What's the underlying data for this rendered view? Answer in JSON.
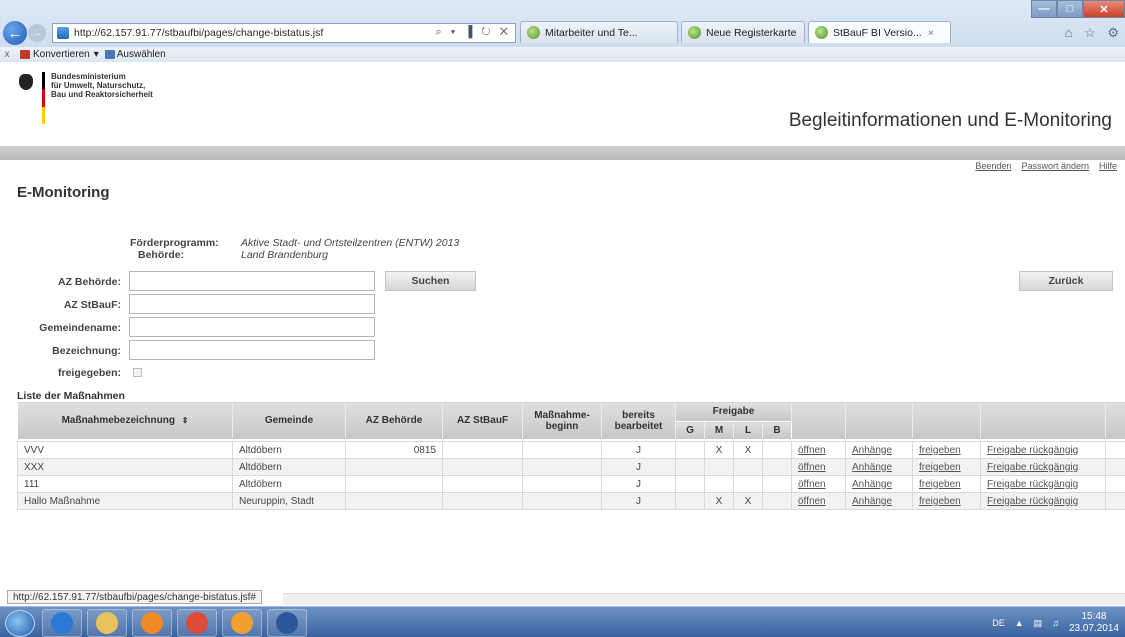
{
  "browser": {
    "url": "http://62.157.91.77/stbaufbi/pages/change-bistatus.jsf",
    "address_controls": "⌕ ▾ ▐ ↻ ✕",
    "tabs": [
      {
        "label": "Mitarbeiter und Te..."
      },
      {
        "label": "Neue Registerkarte"
      },
      {
        "label": "StBauF BI Versio...",
        "active": true
      }
    ],
    "tab_close": "×",
    "commandbar": {
      "close": "x",
      "convert": "Konvertieren",
      "convert_caret": "▾",
      "select": "Auswählen"
    },
    "window_buttons": {
      "minimize": "—",
      "maximize": "□",
      "close": "✕"
    },
    "right_icons": "⌂ ☆ ⚙"
  },
  "header": {
    "ministry_lines": [
      "Bundesministerium",
      "für Umwelt, Naturschutz,",
      "Bau und Reaktorsicherheit"
    ],
    "app_title": "Begleitinformationen und E-Monitoring",
    "links": [
      "Beenden",
      "Passwort ändern",
      "Hilfe"
    ],
    "flag_colors": [
      "#000000",
      "#dd0000",
      "#ffcc00"
    ]
  },
  "page": {
    "title": "E-Monitoring",
    "meta": [
      {
        "label": "Förderprogramm:",
        "value": "Aktive Stadt- und Ortsteilzentren (ENTW) 2013"
      },
      {
        "label": "Behörde:",
        "value": "Land Brandenburg"
      }
    ],
    "form": {
      "az_behoerde": {
        "label": "AZ Behörde:",
        "value": ""
      },
      "az_stbauf": {
        "label": "AZ StBauF:",
        "value": ""
      },
      "gemeindename": {
        "label": "Gemeindename:",
        "value": ""
      },
      "bezeichnung": {
        "label": "Bezeichnung:",
        "value": ""
      },
      "freigegeben": {
        "label": "freigegeben:",
        "checked": false
      }
    },
    "search_button": "Suchen",
    "back_button": "Zurück",
    "list_title": "Liste der Maßnahmen"
  },
  "table": {
    "headers": {
      "name": "Maßnahmebezeichnung",
      "sort_icon": "⇕",
      "gemeinde": "Gemeinde",
      "az_behoerde": "AZ Behörde",
      "az_stbauf": "AZ StBauF",
      "beginn": "Maßnahme-beginn",
      "bearbeitet": "bereits bearbeitet",
      "freigabe": "Freigabe",
      "g": "G",
      "m": "M",
      "l": "L",
      "b": "B"
    },
    "rows": [
      {
        "name": "VVV",
        "gemeinde": "Altdöbern",
        "az_behoerde": "0815",
        "az_stbauf": "",
        "beginn": "",
        "bearbeitet": "J",
        "g": "",
        "m": "X",
        "l": "X",
        "b": "",
        "open": "öffnen",
        "attach": "Anhänge",
        "release": "freigeben",
        "undo": "Freigabe rückgängig"
      },
      {
        "name": "XXX",
        "gemeinde": "Altdöbern",
        "az_behoerde": "",
        "az_stbauf": "",
        "beginn": "",
        "bearbeitet": "J",
        "g": "",
        "m": "",
        "l": "",
        "b": "",
        "open": "öffnen",
        "attach": "Anhänge",
        "release": "freigeben",
        "undo": "Freigabe rückgängig"
      },
      {
        "name": "111",
        "gemeinde": "Altdöbern",
        "az_behoerde": "",
        "az_stbauf": "",
        "beginn": "",
        "bearbeitet": "J",
        "g": "",
        "m": "",
        "l": "",
        "b": "",
        "open": "öffnen",
        "attach": "Anhänge",
        "release": "freigeben",
        "undo": "Freigabe rückgängig"
      },
      {
        "name": "Hallo Maßnahme",
        "gemeinde": "Neuruppin, Stadt",
        "az_behoerde": "",
        "az_stbauf": "",
        "beginn": "",
        "bearbeitet": "J",
        "g": "",
        "m": "X",
        "l": "X",
        "b": "",
        "open": "öffnen",
        "attach": "Anhänge",
        "release": "freigeben",
        "undo": "Freigabe rückgängig"
      }
    ]
  },
  "statusbar": {
    "url": "http://62.157.91.77/stbaufbi/pages/change-bistatus.jsf#"
  },
  "taskbar": {
    "apps": [
      {
        "name": "internet-explorer",
        "color": "#2b79d6"
      },
      {
        "name": "file-explorer",
        "color": "#e8c25a"
      },
      {
        "name": "media-player",
        "color": "#f08a24"
      },
      {
        "name": "chrome",
        "color": "#dd4b39"
      },
      {
        "name": "outlook",
        "color": "#f0a030"
      },
      {
        "name": "word",
        "color": "#2b579a"
      }
    ],
    "language": "DE",
    "time": "15:48",
    "date": "23.07.2014"
  }
}
